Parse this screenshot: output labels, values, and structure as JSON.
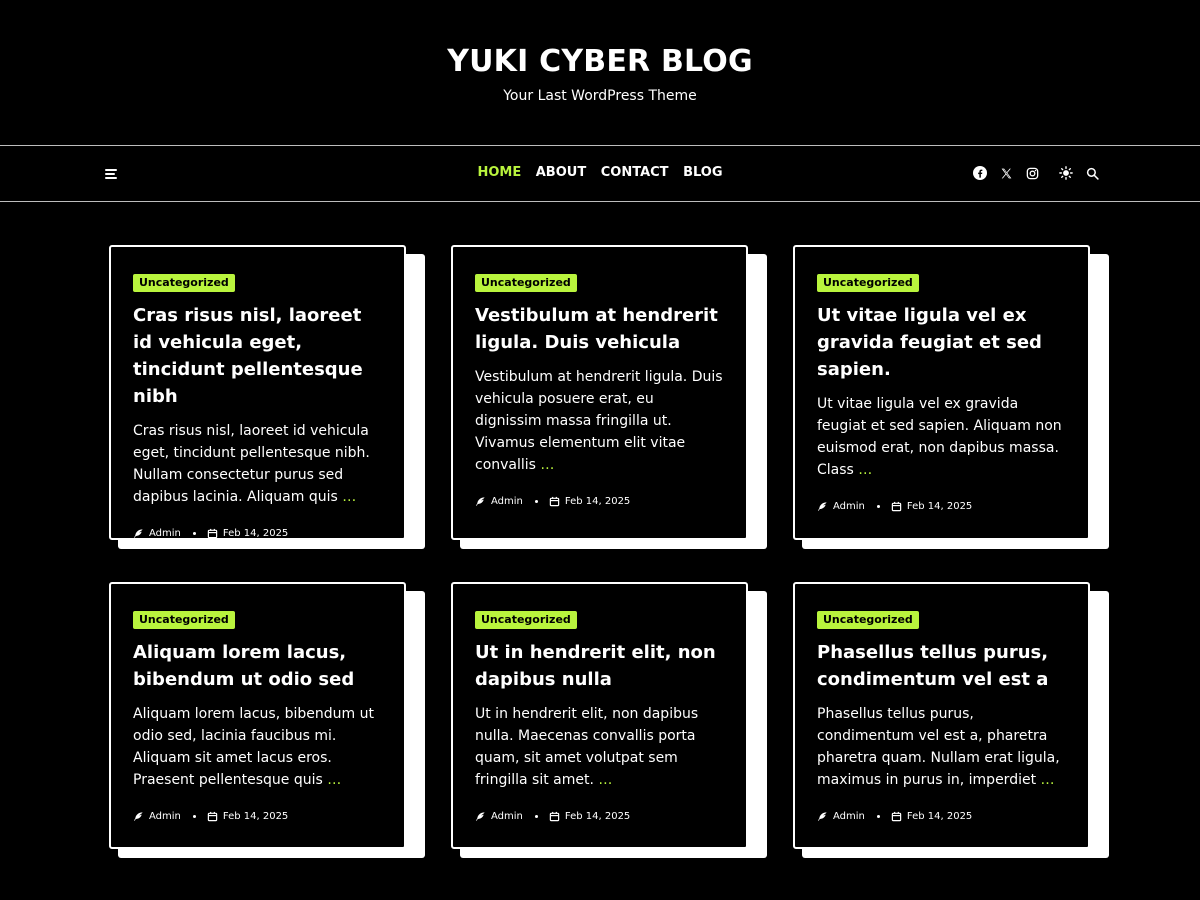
{
  "site": {
    "title": "YUKI CYBER BLOG",
    "tagline": "Your Last WordPress Theme"
  },
  "nav": {
    "menu_icon": "hamburger-icon",
    "links": [
      {
        "label": "HOME",
        "active": true
      },
      {
        "label": "ABOUT",
        "active": false
      },
      {
        "label": "CONTACT",
        "active": false
      },
      {
        "label": "BLOG",
        "active": false
      }
    ],
    "icons": [
      "facebook-icon",
      "x-twitter-icon",
      "instagram-icon",
      "theme-toggle-icon",
      "search-icon"
    ]
  },
  "colors": {
    "accent": "#b9f43d",
    "background": "#000000",
    "text": "#ffffff"
  },
  "posts": [
    {
      "category": "Uncategorized",
      "title": "Cras risus nisl, laoreet id vehicula eget, tincidunt pellentesque nibh",
      "excerpt": "Cras risus nisl, laoreet id vehicula eget, tincidunt pellentesque nibh. Nullam consectetur purus sed dapibus lacinia. Aliquam quis",
      "more": "…",
      "author": "Admin",
      "date": "Feb 14, 2025"
    },
    {
      "category": "Uncategorized",
      "title": "Vestibulum at hendrerit ligula. Duis vehicula",
      "excerpt": "Vestibulum at hendrerit ligula. Duis vehicula posuere erat, eu dignissim massa fringilla ut. Vivamus elementum elit vitae convallis",
      "more": "…",
      "author": "Admin",
      "date": "Feb 14, 2025"
    },
    {
      "category": "Uncategorized",
      "title": "Ut vitae ligula vel ex gravida feugiat et sed sapien.",
      "excerpt": "Ut vitae ligula vel ex gravida feugiat et sed sapien. Aliquam non euismod erat, non dapibus massa. Class",
      "more": "…",
      "author": "Admin",
      "date": "Feb 14, 2025"
    },
    {
      "category": "Uncategorized",
      "title": "Aliquam lorem lacus, bibendum ut odio sed",
      "excerpt": "Aliquam lorem lacus, bibendum ut odio sed, lacinia faucibus mi. Aliquam sit amet lacus eros. Praesent pellentesque quis",
      "more": "…",
      "author": "Admin",
      "date": "Feb 14, 2025"
    },
    {
      "category": "Uncategorized",
      "title": "Ut in hendrerit elit, non dapibus nulla",
      "excerpt": "Ut in hendrerit elit, non dapibus nulla. Maecenas convallis porta quam, sit amet volutpat sem fringilla sit amet.",
      "more": "…",
      "author": "Admin",
      "date": "Feb 14, 2025"
    },
    {
      "category": "Uncategorized",
      "title": "Phasellus tellus purus, condimentum vel est a",
      "excerpt": "Phasellus tellus purus, condimentum vel est a, pharetra pharetra quam. Nullam erat ligula, maximus in purus in, imperdiet",
      "more": "…",
      "author": "Admin",
      "date": "Feb 14, 2025"
    }
  ]
}
